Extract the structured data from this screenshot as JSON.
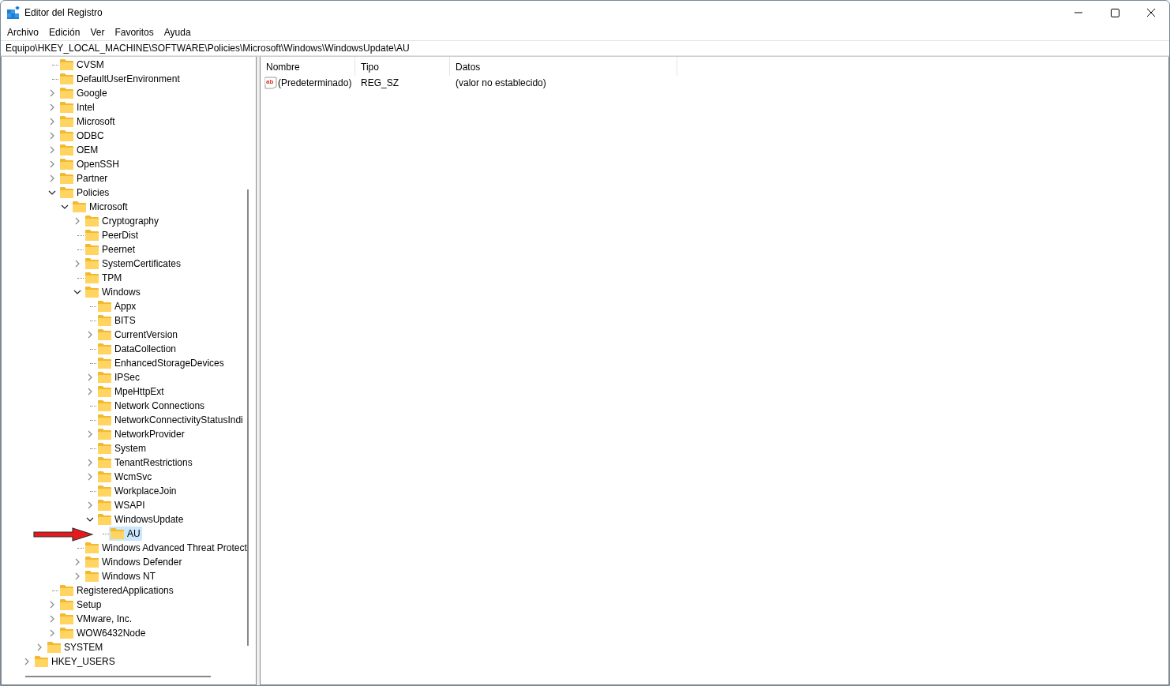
{
  "window": {
    "title": "Editor del Registro"
  },
  "menu": [
    "Archivo",
    "Edición",
    "Ver",
    "Favoritos",
    "Ayuda"
  ],
  "address": "Equipo\\HKEY_LOCAL_MACHINE\\SOFTWARE\\Policies\\Microsoft\\Windows\\WindowsUpdate\\AU",
  "tree": {
    "items": [
      {
        "children": [
          {
            "children": [
              {
                "label": "CVSM",
                "kind": "leaf",
                "selected": false
              },
              {
                "label": "DefaultUserEnvironment",
                "kind": "leaf",
                "selected": false
              },
              {
                "label": "Google",
                "kind": "collapsed",
                "selected": false
              },
              {
                "label": "Intel",
                "kind": "collapsed",
                "selected": false
              },
              {
                "label": "Microsoft",
                "kind": "collapsed",
                "selected": false
              },
              {
                "label": "ODBC",
                "kind": "collapsed",
                "selected": false
              },
              {
                "label": "OEM",
                "kind": "collapsed",
                "selected": false
              },
              {
                "label": "OpenSSH",
                "kind": "collapsed",
                "selected": false
              },
              {
                "label": "Partner",
                "kind": "collapsed",
                "selected": false
              },
              {
                "label": "Policies",
                "kind": "expanded",
                "selected": false,
                "children": [
                  {
                    "label": "Microsoft",
                    "kind": "expanded",
                    "selected": false,
                    "children": [
                      {
                        "label": "Cryptography",
                        "kind": "collapsed",
                        "selected": false
                      },
                      {
                        "label": "PeerDist",
                        "kind": "leaf",
                        "selected": false
                      },
                      {
                        "label": "Peernet",
                        "kind": "leaf",
                        "selected": false
                      },
                      {
                        "label": "SystemCertificates",
                        "kind": "collapsed",
                        "selected": false
                      },
                      {
                        "label": "TPM",
                        "kind": "leaf",
                        "selected": false
                      },
                      {
                        "label": "Windows",
                        "kind": "expanded",
                        "selected": false,
                        "children": [
                          {
                            "label": "Appx",
                            "kind": "leaf",
                            "selected": false
                          },
                          {
                            "label": "BITS",
                            "kind": "leaf",
                            "selected": false
                          },
                          {
                            "label": "CurrentVersion",
                            "kind": "collapsed",
                            "selected": false
                          },
                          {
                            "label": "DataCollection",
                            "kind": "leaf",
                            "selected": false
                          },
                          {
                            "label": "EnhancedStorageDevices",
                            "kind": "leaf",
                            "selected": false
                          },
                          {
                            "label": "IPSec",
                            "kind": "collapsed",
                            "selected": false
                          },
                          {
                            "label": "MpeHttpExt",
                            "kind": "collapsed",
                            "selected": false
                          },
                          {
                            "label": "Network Connections",
                            "kind": "leaf",
                            "selected": false
                          },
                          {
                            "label": "NetworkConnectivityStatusIndi",
                            "kind": "leaf",
                            "selected": false
                          },
                          {
                            "label": "NetworkProvider",
                            "kind": "collapsed",
                            "selected": false
                          },
                          {
                            "label": "System",
                            "kind": "leaf",
                            "selected": false
                          },
                          {
                            "label": "TenantRestrictions",
                            "kind": "collapsed",
                            "selected": false
                          },
                          {
                            "label": "WcmSvc",
                            "kind": "collapsed",
                            "selected": false
                          },
                          {
                            "label": "WorkplaceJoin",
                            "kind": "leaf",
                            "selected": false
                          },
                          {
                            "label": "WSAPI",
                            "kind": "collapsed",
                            "selected": false
                          },
                          {
                            "label": "WindowsUpdate",
                            "kind": "expanded",
                            "selected": false,
                            "children": [
                              {
                                "label": "AU",
                                "kind": "leaf",
                                "selected": true
                              }
                            ]
                          }
                        ]
                      },
                      {
                        "label": "Windows Advanced Threat Protect",
                        "kind": "leaf",
                        "selected": false
                      },
                      {
                        "label": "Windows Defender",
                        "kind": "collapsed",
                        "selected": false
                      },
                      {
                        "label": "Windows NT",
                        "kind": "collapsed",
                        "selected": false
                      }
                    ]
                  }
                ]
              },
              {
                "label": "RegisteredApplications",
                "kind": "leaf",
                "selected": false
              },
              {
                "label": "Setup",
                "kind": "collapsed",
                "selected": false
              },
              {
                "label": "VMware, Inc.",
                "kind": "collapsed",
                "selected": false
              },
              {
                "label": "WOW6432Node",
                "kind": "collapsed",
                "selected": false
              }
            ]
          },
          {
            "label": "SYSTEM",
            "kind": "collapsed",
            "selected": false
          }
        ]
      },
      {
        "label": "HKEY_USERS",
        "kind": "collapsed",
        "selected": false
      }
    ]
  },
  "values": {
    "columns": [
      "Nombre",
      "Tipo",
      "Datos"
    ],
    "rows": [
      {
        "icon_text": "ab",
        "name": "(Predeterminado)",
        "type": "REG_SZ",
        "data": "(valor no establecido)"
      }
    ]
  }
}
